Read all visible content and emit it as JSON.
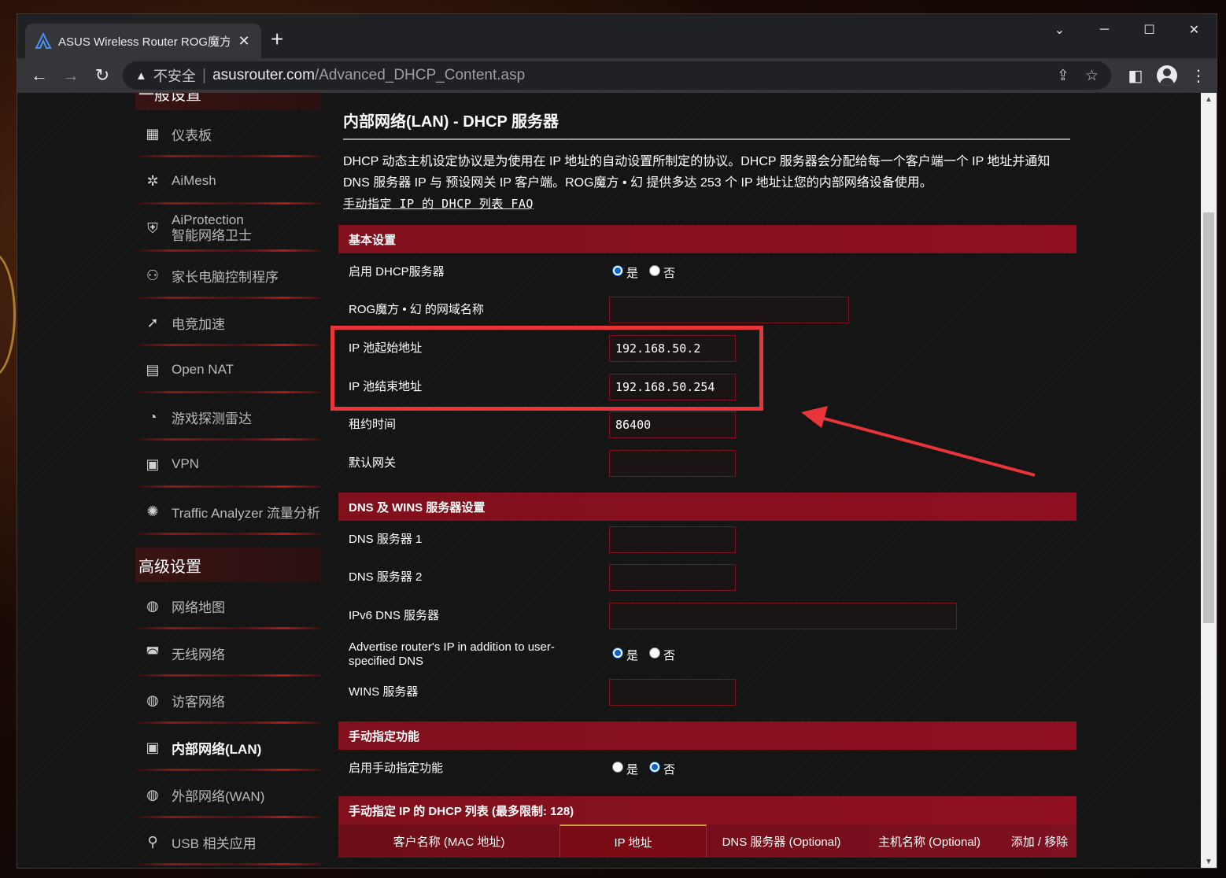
{
  "browser": {
    "tab_title": "ASUS Wireless Router ROG魔方",
    "new_tab": "+",
    "not_secure": "不安全",
    "url_host": "asusrouter.com",
    "url_path": "/Advanced_DHCP_Content.asp"
  },
  "sidebar": {
    "general_header": "一般设置",
    "advanced_header": "高级设置",
    "general_items": [
      {
        "label": "仪表板",
        "icon": "dashboard-icon"
      },
      {
        "label": "AiMesh",
        "icon": "aimesh-icon"
      },
      {
        "label": "AiProtection",
        "sub": "智能网络卫士",
        "icon": "shield-lock-icon"
      },
      {
        "label": "家长电脑控制程序",
        "icon": "parental-control-icon"
      },
      {
        "label": "电竞加速",
        "icon": "rocket-icon"
      },
      {
        "label": "Open NAT",
        "icon": "open-nat-icon"
      },
      {
        "label": "游戏探测雷达",
        "icon": "radar-icon"
      },
      {
        "label": "VPN",
        "icon": "vpn-icon"
      },
      {
        "label": "Traffic Analyzer 流量分析",
        "icon": "traffic-analyzer-icon"
      }
    ],
    "advanced_items": [
      {
        "label": "网络地图",
        "icon": "globe-icon"
      },
      {
        "label": "无线网络",
        "icon": "wifi-icon"
      },
      {
        "label": "访客网络",
        "icon": "guest-network-icon"
      },
      {
        "label": "内部网络(LAN)",
        "icon": "lan-icon",
        "active": true
      },
      {
        "label": "外部网络(WAN)",
        "icon": "wan-globe-icon"
      },
      {
        "label": "USB 相关应用",
        "icon": "usb-icon"
      }
    ]
  },
  "main": {
    "title": "内部网络(LAN) - DHCP 服务器",
    "description_line1": "DHCP 动态主机设定协议是为使用在 IP 地址的自动设置所制定的协议。DHCP 服务器会分配给每一个客户端一个 IP 地址并通知",
    "description_line2": "DNS 服务器 IP 与 预设网关 IP 客户端。ROG魔方 • 幻 提供多达 253 个 IP 地址让您的内部网络设备使用。",
    "faq_link": "手动指定 IP 的 DHCP 列表 FAQ",
    "basic": {
      "header": "基本设置",
      "enable_dhcp_label": "启用 DHCP服务器",
      "yes": "是",
      "no": "否",
      "domain_label": "ROG魔方 • 幻 的网域名称",
      "domain_value": "",
      "pool_start_label": "IP 池起始地址",
      "pool_start_value": "192.168.50.2",
      "pool_end_label": "IP 池结束地址",
      "pool_end_value": "192.168.50.254",
      "lease_label": "租约时间",
      "lease_value": "86400",
      "gateway_label": "默认网关",
      "gateway_value": ""
    },
    "dns": {
      "header": "DNS 及 WINS 服务器设置",
      "dns1_label": "DNS 服务器 1",
      "dns1_value": "",
      "dns2_label": "DNS 服务器 2",
      "dns2_value": "",
      "ipv6_dns_label": "IPv6 DNS 服务器",
      "ipv6_dns_value": "",
      "advertise_label": "Advertise router's IP in addition to user-specified DNS",
      "wins_label": "WINS 服务器",
      "wins_value": ""
    },
    "manual": {
      "header": "手动指定功能",
      "enable_manual_label": "启用手动指定功能"
    },
    "list": {
      "header": "手动指定 IP 的 DHCP 列表 (最多限制:  128)",
      "columns": [
        "客户名称 (MAC 地址)",
        "IP 地址",
        "DNS 服务器 (Optional)",
        "主机名称 (Optional)",
        "添加 / 移除"
      ]
    }
  },
  "colors": {
    "accent_red": "#8e1020",
    "annotation_red": "#e8353a",
    "radio_blue": "#0b63ce"
  }
}
